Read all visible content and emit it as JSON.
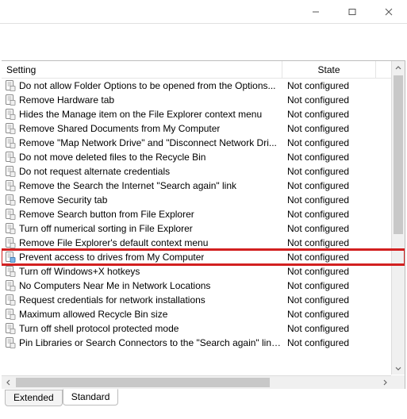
{
  "columns": {
    "setting": "Setting",
    "state": "State"
  },
  "tabs": {
    "extended": "Extended",
    "standard": "Standard"
  },
  "default_state": "Not configured",
  "rows": [
    {
      "label": "Do not allow Folder Options to be opened from the Options...",
      "state": "Not configured",
      "highlight": false
    },
    {
      "label": "Remove Hardware tab",
      "state": "Not configured",
      "highlight": false
    },
    {
      "label": "Hides the Manage item on the File Explorer context menu",
      "state": "Not configured",
      "highlight": false
    },
    {
      "label": "Remove Shared Documents from My Computer",
      "state": "Not configured",
      "highlight": false
    },
    {
      "label": "Remove \"Map Network Drive\" and \"Disconnect Network Dri...",
      "state": "Not configured",
      "highlight": false
    },
    {
      "label": "Do not move deleted files to the Recycle Bin",
      "state": "Not configured",
      "highlight": false
    },
    {
      "label": "Do not request alternate credentials",
      "state": "Not configured",
      "highlight": false
    },
    {
      "label": "Remove the Search the Internet \"Search again\" link",
      "state": "Not configured",
      "highlight": false
    },
    {
      "label": "Remove Security tab",
      "state": "Not configured",
      "highlight": false
    },
    {
      "label": "Remove Search button from File Explorer",
      "state": "Not configured",
      "highlight": false
    },
    {
      "label": "Turn off numerical sorting in File Explorer",
      "state": "Not configured",
      "highlight": false
    },
    {
      "label": "Remove File Explorer's default context menu",
      "state": "Not configured",
      "highlight": false
    },
    {
      "label": "Prevent access to drives from My Computer",
      "state": "Not configured",
      "highlight": true
    },
    {
      "label": "Turn off Windows+X hotkeys",
      "state": "Not configured",
      "highlight": false
    },
    {
      "label": "No Computers Near Me in Network Locations",
      "state": "Not configured",
      "highlight": false
    },
    {
      "label": "Request credentials for network installations",
      "state": "Not configured",
      "highlight": false
    },
    {
      "label": "Maximum allowed Recycle Bin size",
      "state": "Not configured",
      "highlight": false
    },
    {
      "label": "Turn off shell protocol protected mode",
      "state": "Not configured",
      "highlight": false
    },
    {
      "label": "Pin Libraries or Search Connectors to the \"Search again\" link...",
      "state": "Not configured",
      "highlight": false
    }
  ]
}
